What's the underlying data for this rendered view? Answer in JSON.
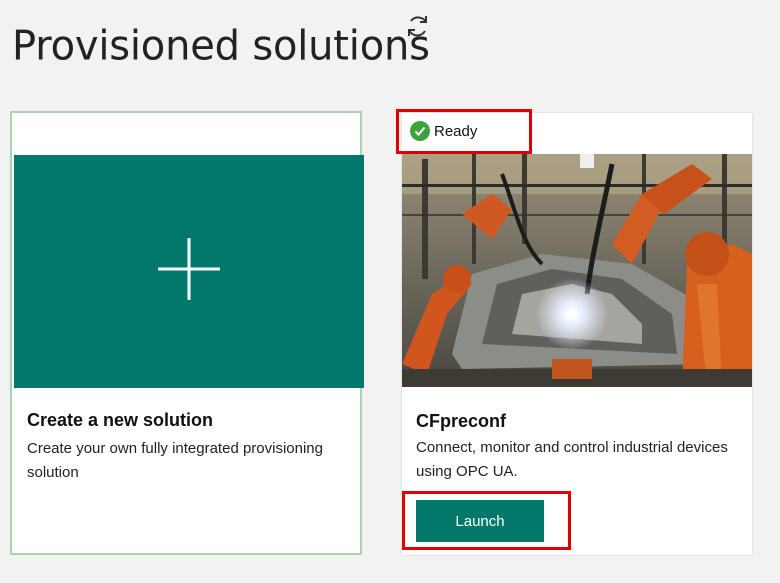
{
  "header": {
    "title": "Provisioned solutions"
  },
  "new_solution_card": {
    "title": "Create a new solution",
    "description": "Create your own fully integrated provisioning solution"
  },
  "solution_card": {
    "status": "Ready",
    "name": "CFpreconf",
    "description": "Connect, monitor and control industrial devices using OPC UA.",
    "launch_label": "Launch"
  },
  "colors": {
    "accent": "#00796b",
    "status_ready": "#3ca33c",
    "highlight": "#e00000",
    "new_card_border": "#a8d5a8"
  },
  "icons": {
    "refresh": "refresh-icon",
    "plus": "plus-icon",
    "status": "checkmark-icon"
  }
}
